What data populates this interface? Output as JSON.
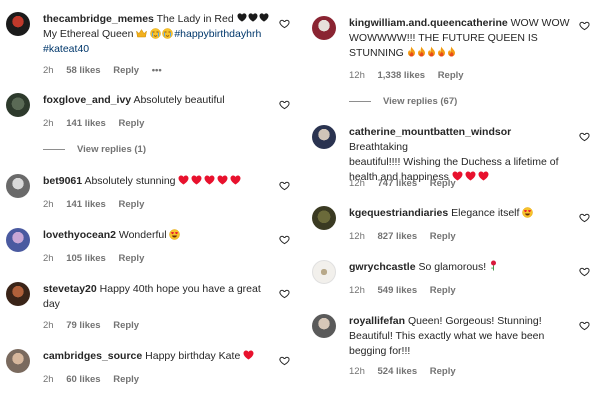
{
  "icons": {
    "like": "heart-outline-icon",
    "more": "more-horizontal-icon"
  },
  "colors": {
    "meta": "#737373",
    "hashtag": "#00376b",
    "heart_red": "#e8112d",
    "text": "#262626"
  },
  "left": [
    {
      "username": "thecambridge_memes",
      "text": "The Lady in Red",
      "text2": "My Ethereal Queen",
      "hashtags": "#happybirthdayhrh",
      "hashtags2": "#kateat40",
      "time": "2h",
      "likes": "58 likes",
      "reply": "Reply",
      "more": "•••"
    },
    {
      "username": "foxglove_and_ivy",
      "text": "Absolutely beautiful",
      "time": "2h",
      "likes": "141 likes",
      "reply": "Reply",
      "view_replies": "View replies (1)"
    },
    {
      "username": "bet9061",
      "text": "Absolutely stunning",
      "time": "2h",
      "likes": "141 likes",
      "reply": "Reply"
    },
    {
      "username": "lovethyocean2",
      "text": "Wonderful",
      "time": "2h",
      "likes": "105 likes",
      "reply": "Reply"
    },
    {
      "username": "stevetay20",
      "text": "Happy 40th hope you have a great",
      "text2": "day",
      "time": "2h",
      "likes": "79 likes",
      "reply": "Reply"
    },
    {
      "username": "cambridges_source",
      "text": "Happy birthday Kate",
      "time": "2h",
      "likes": "60 likes",
      "reply": "Reply"
    }
  ],
  "right": [
    {
      "username": "kingwilliam.and.queencatherine",
      "text": "WOW WOW",
      "text2": "WOWWWW!!! THE FUTURE QUEEN IS",
      "text3": "STUNNING",
      "time": "12h",
      "likes": "1,338 likes",
      "reply": "Reply",
      "view_replies": "View replies (67)"
    },
    {
      "username": "catherine_mountbatten_windsor",
      "text": "Breathtaking",
      "text2": "beautiful!!!! Wishing the Duchess a lifetime of",
      "text3": "health and happiness",
      "time": "12h",
      "likes": "747 likes",
      "reply": "Reply"
    },
    {
      "username": "kgequestriandiaries",
      "text": "Elegance itself",
      "time": "12h",
      "likes": "827 likes",
      "reply": "Reply"
    },
    {
      "username": "gwrychcastle",
      "text": "So glamorous!",
      "time": "12h",
      "likes": "549 likes",
      "reply": "Reply"
    },
    {
      "username": "royallifefan",
      "text": "Queen! Gorgeous! Stunning!",
      "text2": "Beautiful! This exactly what we have been",
      "text3": "begging for!!!",
      "time": "12h",
      "likes": "524 likes",
      "reply": "Reply"
    }
  ]
}
